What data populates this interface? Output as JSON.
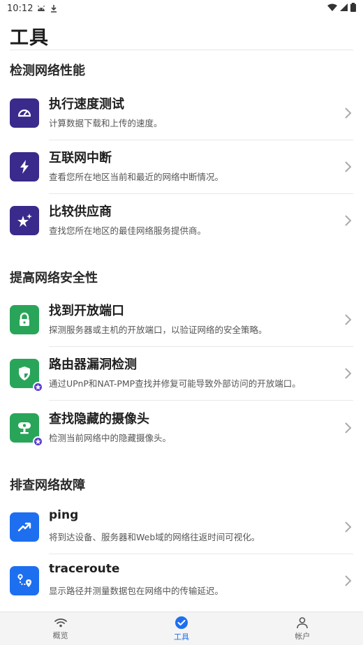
{
  "status_bar": {
    "time": "10:12"
  },
  "page_title": "工具",
  "sections": [
    {
      "title": "检测网络性能"
    },
    {
      "title": "提高网络安全性"
    },
    {
      "title": "排查网络故障"
    }
  ],
  "items": [
    {
      "name": "执行速度测试",
      "desc": "计算数据下载和上传的速度。",
      "icon": "speedometer-icon",
      "color": "#3a2a8c"
    },
    {
      "name": "互联网中断",
      "desc": "查看您所在地区当前和最近的网络中断情况。",
      "icon": "lightning-icon",
      "color": "#3a2a8c"
    },
    {
      "name": "比较供应商",
      "desc": "查找您所在地区的最佳网络服务提供商。",
      "icon": "star-sparkle-icon",
      "color": "#3a2a8c"
    },
    {
      "name": "找到开放端口",
      "desc": "探测服务器或主机的开放端口，以验证网络的安全策略。",
      "icon": "lock-icon",
      "color": "#29a55a"
    },
    {
      "name": "路由器漏洞检测",
      "desc": "通过UPnP和NAT-PMP查找并修复可能导致外部访问的开放端口。",
      "icon": "shield-icon",
      "color": "#29a55a",
      "premium": true
    },
    {
      "name": "查找隐藏的摄像头",
      "desc": "检测当前网络中的隐藏摄像头。",
      "icon": "camera-icon",
      "color": "#29a55a",
      "premium": true
    },
    {
      "name": "ping",
      "desc": "将到达设备、服务器和Web域的网络往返时间可视化。",
      "icon": "trend-icon",
      "color": "#1d6ff0"
    },
    {
      "name": "traceroute",
      "desc": "显示路径并测量数据包在网络中的传输延迟。",
      "icon": "route-icon",
      "color": "#1d6ff0"
    }
  ],
  "bottom_nav": [
    {
      "label": "概览",
      "icon": "wifi-icon"
    },
    {
      "label": "工具",
      "icon": "check-circle-icon",
      "active": true
    },
    {
      "label": "帐户",
      "icon": "person-icon"
    }
  ]
}
